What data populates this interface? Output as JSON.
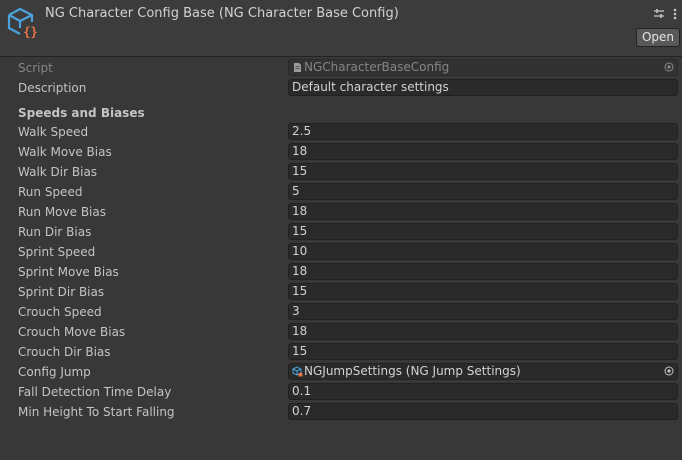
{
  "header": {
    "title": "NG Character Config Base (NG Character Base Config)",
    "open_label": "Open",
    "icons": [
      "scriptable-object-icon",
      "settings-sliders-icon",
      "more-vert-icon"
    ]
  },
  "script_row": {
    "label": "Script",
    "value": "NGCharacterBaseConfig"
  },
  "description_row": {
    "label": "Description",
    "value": "Default character settings"
  },
  "section_title": "Speeds and Biases",
  "fields": [
    {
      "label": "Walk Speed",
      "value": "2.5"
    },
    {
      "label": "Walk Move Bias",
      "value": "18"
    },
    {
      "label": "Walk Dir Bias",
      "value": "15"
    },
    {
      "label": "Run Speed",
      "value": "5"
    },
    {
      "label": "Run Move Bias",
      "value": "18"
    },
    {
      "label": "Run Dir Bias",
      "value": "15"
    },
    {
      "label": "Sprint Speed",
      "value": "10"
    },
    {
      "label": "Sprint Move Bias",
      "value": "18"
    },
    {
      "label": "Sprint Dir Bias",
      "value": "15"
    },
    {
      "label": "Crouch Speed",
      "value": "3"
    },
    {
      "label": "Crouch Move Bias",
      "value": "18"
    },
    {
      "label": "Crouch Dir Bias",
      "value": "15"
    }
  ],
  "config_jump": {
    "label": "Config Jump",
    "value": "NGJumpSettings (NG Jump Settings)"
  },
  "fall_delay": {
    "label": "Fall Detection Time Delay",
    "value": "0.1"
  },
  "min_height": {
    "label": "Min Height To Start Falling",
    "value": "0.7"
  },
  "colors": {
    "background": "#383838",
    "header_background": "#3c3c3c",
    "field_background": "#2a2a2a",
    "icon_blue": "#4aa3df",
    "icon_orange": "#e8734a"
  }
}
